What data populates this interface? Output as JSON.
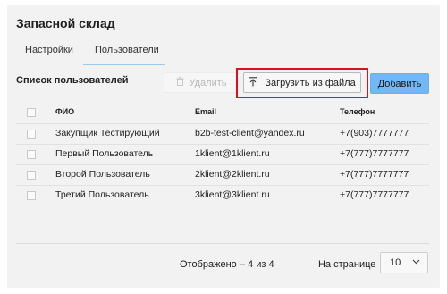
{
  "page": {
    "title": "Запасной склад"
  },
  "tabs": [
    {
      "label": "Настройки",
      "active": false
    },
    {
      "label": "Пользователи",
      "active": true
    }
  ],
  "list": {
    "title": "Список пользователей",
    "delete_label": "Удалить",
    "delete_icon": "trash-icon",
    "upload_label": "Загрузить из файла",
    "upload_icon": "upload-icon",
    "add_label": "Добавить"
  },
  "table": {
    "columns": [
      "ФИО",
      "Email",
      "Телефон"
    ],
    "rows": [
      {
        "name": "Закупщик Тестирующий",
        "email": "b2b-test-client@yandex.ru",
        "phone": "+7(903)7777777"
      },
      {
        "name": "Первый Пользователь",
        "email": "1klient@1klient.ru",
        "phone": "+7(777)7777777"
      },
      {
        "name": "Второй Пользователь",
        "email": "2klient@2klient.ru",
        "phone": "+7(777)7777777"
      },
      {
        "name": "Третий Пользователь",
        "email": "3klient@3klient.ru",
        "phone": "+7(777)7777777"
      }
    ]
  },
  "footer": {
    "count_text": "Отображено – 4 из 4",
    "per_page_label": "На странице",
    "per_page_value": "10"
  },
  "colors": {
    "highlight": "#d6141e",
    "primary_button": "#72b8f4",
    "tab_underline": "#9fc7ea"
  }
}
